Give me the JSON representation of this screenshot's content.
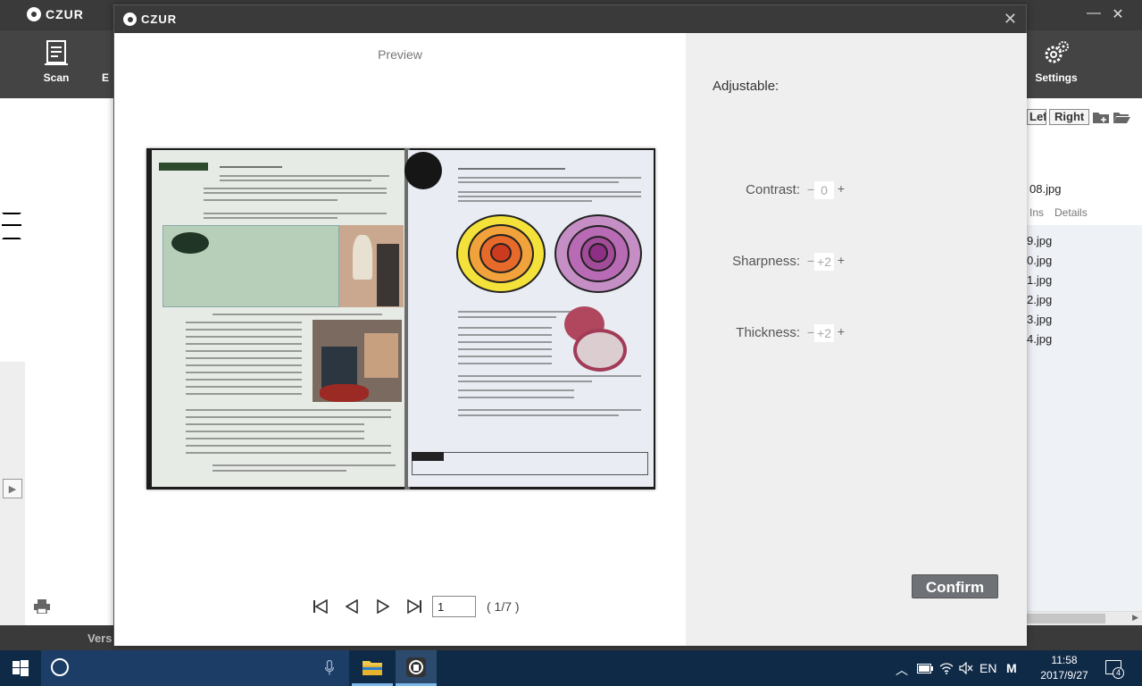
{
  "app": {
    "logo_text": "CZUR",
    "toolbar": {
      "scan_label": "Scan",
      "settings_label": "Settings",
      "partial_label": "E"
    },
    "rotate": {
      "left_label": "Left",
      "right_label": "Right"
    },
    "file_panel": {
      "current_file": "08.jpg",
      "tab_ins": "Ins",
      "tab_details": "Details",
      "items": [
        "9.jpg",
        "0.jpg",
        "1.jpg",
        "2.jpg",
        "3.jpg",
        "4.jpg"
      ]
    },
    "status_partial": "Vers"
  },
  "dialog": {
    "logo_text": "CZUR",
    "close_glyph": "✕",
    "preview_label": "Preview",
    "pagination": {
      "current_page": "1",
      "total_label": "( 1/7 )"
    },
    "adjustable_label": "Adjustable:",
    "adjustments": [
      {
        "label": "Contrast:",
        "value": "0"
      },
      {
        "label": "Sharpness:",
        "value": "+2"
      },
      {
        "label": "Thickness:",
        "value": "+2"
      }
    ],
    "confirm_label": "Confirm"
  },
  "taskbar": {
    "lang": "EN",
    "ime": "M",
    "time": "11:58",
    "date": "2017/9/27",
    "notification_count": "4"
  },
  "colors": {
    "titlebar": "#3a3a3a",
    "taskbar": "#0f2a47",
    "confirm_button": "#6e7276"
  }
}
